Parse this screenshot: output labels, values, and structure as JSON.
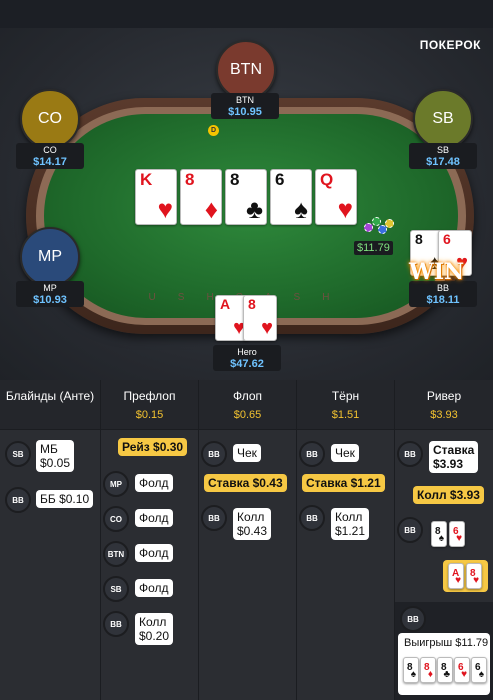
{
  "brand": "ПОКЕРОК",
  "table": {
    "rail_text": "USHCASH",
    "pot": "$11.79",
    "win_label": "WIN",
    "dealer_chip": "D"
  },
  "players": [
    {
      "id": "btn",
      "avatar": "BTN",
      "name": "BTN",
      "stack": "$10.95",
      "color": "#7a3a2e"
    },
    {
      "id": "co",
      "avatar": "CO",
      "name": "CO",
      "stack": "$14.17",
      "color": "#9a7a14"
    },
    {
      "id": "sb",
      "avatar": "SB",
      "name": "SB",
      "stack": "$17.48",
      "color": "#6b7a2a"
    },
    {
      "id": "mp",
      "avatar": "MP",
      "name": "MP",
      "stack": "$10.93",
      "color": "#2a4a7a"
    },
    {
      "id": "bb",
      "name": "BB",
      "stack": "$18.11"
    },
    {
      "id": "hero",
      "name": "Hero",
      "stack": "$47.62"
    }
  ],
  "board": [
    {
      "rank": "K",
      "suit": "♥"
    },
    {
      "rank": "8",
      "suit": "♦"
    },
    {
      "rank": "8",
      "suit": "♣"
    },
    {
      "rank": "6",
      "suit": "♠"
    },
    {
      "rank": "Q",
      "suit": "♥"
    }
  ],
  "bb_cards": [
    {
      "rank": "8",
      "suit": "♠"
    },
    {
      "rank": "6",
      "suit": "♥"
    }
  ],
  "hero_cards": [
    {
      "rank": "A",
      "suit": "♥"
    },
    {
      "rank": "8",
      "suit": "♥"
    }
  ],
  "history": {
    "columns": [
      {
        "title": "Блайнды (Анте)",
        "pot": ""
      },
      {
        "title": "Префлоп",
        "pot": "$0.15"
      },
      {
        "title": "Флоп",
        "pot": "$0.65"
      },
      {
        "title": "Тёрн",
        "pot": "$1.51"
      },
      {
        "title": "Ривер",
        "pot": "$3.93"
      }
    ],
    "blinds": [
      {
        "pos": "SB",
        "a1": "МБ",
        "a2": "$0.05"
      },
      {
        "pos": "BB",
        "a1": "ББ $0.10"
      }
    ],
    "preflop": {
      "raise": "Рейз $0.30",
      "rows": [
        {
          "pos": "MP",
          "act": "Фолд"
        },
        {
          "pos": "CO",
          "act": "Фолд"
        },
        {
          "pos": "BTN",
          "act": "Фолд"
        },
        {
          "pos": "SB",
          "act": "Фолд"
        },
        {
          "pos": "BB",
          "a1": "Колл",
          "a2": "$0.20"
        }
      ]
    },
    "flop": {
      "check_pos": "BB",
      "check": "Чек",
      "bet": "Ставка $0.43",
      "call_pos": "BB",
      "a1": "Колл",
      "a2": "$0.43"
    },
    "turn": {
      "check_pos": "BB",
      "check": "Чек",
      "bet": "Ставка $1.21",
      "call_pos": "BB",
      "a1": "Колл",
      "a2": "$1.21"
    },
    "river": {
      "bet_pos": "BB",
      "a1": "Ставка",
      "a2": "$3.93",
      "call": "Колл $3.93",
      "show_pos": "BB",
      "win_pos": "BB",
      "win": "Выигрыш $11.79"
    }
  }
}
